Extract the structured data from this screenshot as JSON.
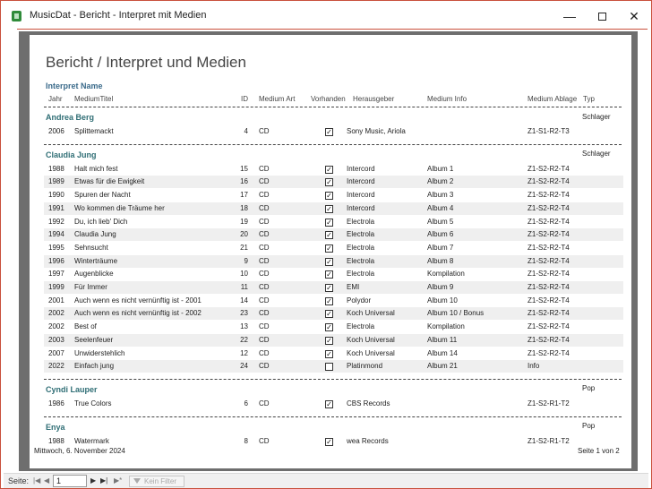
{
  "window": {
    "title": "MusicDat - Bericht - Interpret mit Medien"
  },
  "report": {
    "title": "Bericht / Interpret und Medien",
    "group_header": "Interpret Name",
    "columns": {
      "jahr": "Jahr",
      "titel": "MediumTitel",
      "id": "ID",
      "art": "Medium Art",
      "vorhanden": "Vorhanden",
      "herausgeber": "Herausgeber",
      "info": "Medium Info",
      "ablage": "Medium Ablage",
      "typ": "Typ"
    },
    "groups": [
      {
        "artist": "Andrea Berg",
        "genre": "Schlager",
        "rows": [
          {
            "jahr": "2006",
            "titel": "Splittemackt",
            "id": "4",
            "art": "CD",
            "checked": true,
            "herausgeber": "Sony Music, Ariola",
            "info": "",
            "ablage": "Z1-S1-R2-T3"
          }
        ]
      },
      {
        "artist": "Claudia Jung",
        "genre": "Schlager",
        "rows": [
          {
            "jahr": "1988",
            "titel": "Halt mich fest",
            "id": "15",
            "art": "CD",
            "checked": true,
            "herausgeber": "Intercord",
            "info": "Album 1",
            "ablage": "Z1-S2-R2-T4"
          },
          {
            "jahr": "1989",
            "titel": "Etwas für die Ewigkeit",
            "id": "16",
            "art": "CD",
            "checked": true,
            "herausgeber": "Intercord",
            "info": "Album 2",
            "ablage": "Z1-S2-R2-T4"
          },
          {
            "jahr": "1990",
            "titel": "Spuren der Nacht",
            "id": "17",
            "art": "CD",
            "checked": true,
            "herausgeber": "Intercord",
            "info": "Album 3",
            "ablage": "Z1-S2-R2-T4"
          },
          {
            "jahr": "1991",
            "titel": "Wo kommen die Träume her",
            "id": "18",
            "art": "CD",
            "checked": true,
            "herausgeber": "Intercord",
            "info": "Album 4",
            "ablage": "Z1-S2-R2-T4"
          },
          {
            "jahr": "1992",
            "titel": "Du, ich lieb' Dich",
            "id": "19",
            "art": "CD",
            "checked": true,
            "herausgeber": "Electrola",
            "info": "Album 5",
            "ablage": "Z1-S2-R2-T4"
          },
          {
            "jahr": "1994",
            "titel": "Claudia Jung",
            "id": "20",
            "art": "CD",
            "checked": true,
            "herausgeber": "Electrola",
            "info": "Album 6",
            "ablage": "Z1-S2-R2-T4"
          },
          {
            "jahr": "1995",
            "titel": "Sehnsucht",
            "id": "21",
            "art": "CD",
            "checked": true,
            "herausgeber": "Electrola",
            "info": "Album 7",
            "ablage": "Z1-S2-R2-T4"
          },
          {
            "jahr": "1996",
            "titel": "Winterträume",
            "id": "9",
            "art": "CD",
            "checked": true,
            "herausgeber": "Electrola",
            "info": "Album 8",
            "ablage": "Z1-S2-R2-T4"
          },
          {
            "jahr": "1997",
            "titel": "Augenblicke",
            "id": "10",
            "art": "CD",
            "checked": true,
            "herausgeber": "Electrola",
            "info": "Kompilation",
            "ablage": "Z1-S2-R2-T4"
          },
          {
            "jahr": "1999",
            "titel": "Für Immer",
            "id": "11",
            "art": "CD",
            "checked": true,
            "herausgeber": "EMI",
            "info": "Album 9",
            "ablage": "Z1-S2-R2-T4"
          },
          {
            "jahr": "2001",
            "titel": "Auch wenn es nicht vernünftig ist - 2001",
            "id": "14",
            "art": "CD",
            "checked": true,
            "herausgeber": "Polydor",
            "info": "Album 10",
            "ablage": "Z1-S2-R2-T4"
          },
          {
            "jahr": "2002",
            "titel": "Auch wenn es nicht vernünftig ist - 2002",
            "id": "23",
            "art": "CD",
            "checked": true,
            "herausgeber": "Koch Universal",
            "info": "Album 10 / Bonus",
            "ablage": "Z1-S2-R2-T4"
          },
          {
            "jahr": "2002",
            "titel": "Best of",
            "id": "13",
            "art": "CD",
            "checked": true,
            "herausgeber": "Electrola",
            "info": "Kompilation",
            "ablage": "Z1-S2-R2-T4"
          },
          {
            "jahr": "2003",
            "titel": "Seelenfeuer",
            "id": "22",
            "art": "CD",
            "checked": true,
            "herausgeber": "Koch Universal",
            "info": "Album 11",
            "ablage": "Z1-S2-R2-T4"
          },
          {
            "jahr": "2007",
            "titel": "Unwiderstehlich",
            "id": "12",
            "art": "CD",
            "checked": true,
            "herausgeber": "Koch Universal",
            "info": "Album 14",
            "ablage": "Z1-S2-R2-T4"
          },
          {
            "jahr": "2022",
            "titel": "Einfach jung",
            "id": "24",
            "art": "CD",
            "checked": false,
            "herausgeber": "Platinmond",
            "info": "Album 21",
            "ablage": "Info"
          }
        ]
      },
      {
        "artist": "Cyndi Lauper",
        "genre": "Pop",
        "rows": [
          {
            "jahr": "1986",
            "titel": "True Colors",
            "id": "6",
            "art": "CD",
            "checked": true,
            "herausgeber": "CBS Records",
            "info": "",
            "ablage": "Z1-S2-R1-T2"
          }
        ]
      },
      {
        "artist": "Enya",
        "genre": "Pop",
        "rows": [
          {
            "jahr": "1988",
            "titel": "Watermark",
            "id": "8",
            "art": "CD",
            "checked": true,
            "herausgeber": "wea Records",
            "info": "",
            "ablage": "Z1-S2-R1-T2"
          }
        ]
      }
    ],
    "footer": {
      "date": "Mittwoch, 6. November 2024",
      "page": "Seite 1 von 2"
    }
  },
  "statusbar": {
    "label": "Seite:",
    "page_value": "1",
    "filter_label": "Kein Filter"
  },
  "colors": {
    "accent": "#c9503c",
    "artist": "#2f6e75",
    "header": "#3a6a8a"
  },
  "icons": {
    "app": "access-report-icon",
    "check": "checkbox-checked-icon"
  }
}
